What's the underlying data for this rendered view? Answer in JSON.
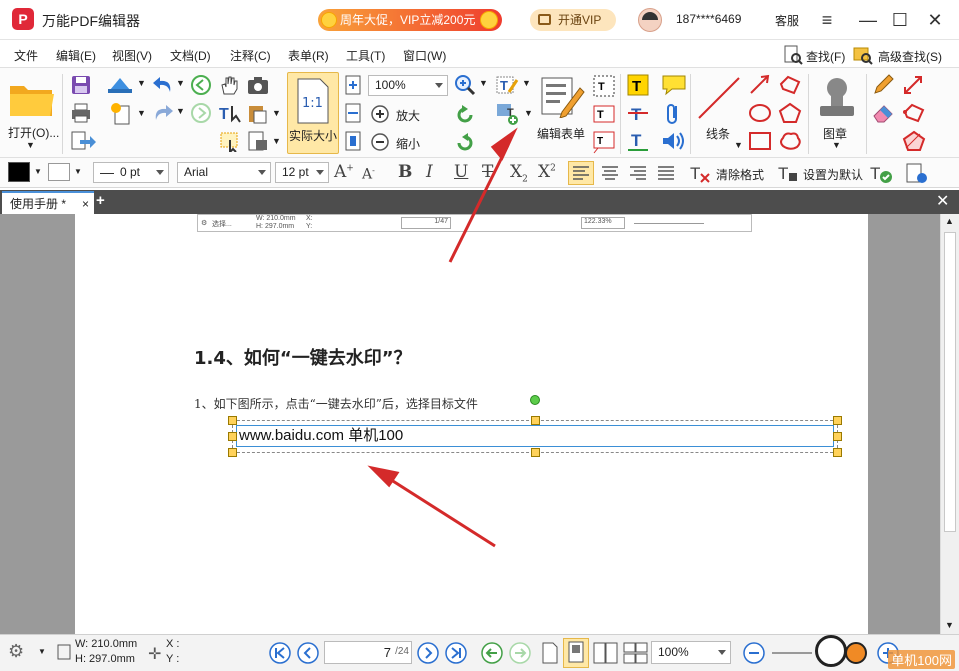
{
  "app": {
    "logo_letter": "P",
    "title": "万能PDF编辑器"
  },
  "promo": {
    "label": "周年大促，VIP立减200元"
  },
  "vip": {
    "label": "开通VIP"
  },
  "user": {
    "phone": "187****6469",
    "service": "客服"
  },
  "window": {
    "menu_icon": "hamburger-icon",
    "min": "—",
    "max": "☐",
    "close": "✕"
  },
  "menu": {
    "items": [
      "文件",
      "编辑(E)",
      "视图(V)",
      "文档(D)",
      "注释(C)",
      "表单(R)",
      "工具(T)",
      "窗口(W)"
    ],
    "search": "查找(F)",
    "advanced_search": "高级查找(S)"
  },
  "toolbar": {
    "open": "打开(O)...",
    "actual_size": "实际大小",
    "actual_size_icon": "1:1",
    "zoom_value": "100%",
    "zoom_in": "放大",
    "zoom_out": "缩小",
    "edit_form": "编辑表单",
    "lines": "线条",
    "stamp": "图章"
  },
  "format": {
    "stroke_width": "0 pt",
    "font": "Arial",
    "font_size": "12 pt",
    "clear_format": "清除格式",
    "set_default": "设置为默认"
  },
  "tabs": {
    "active": "使用手册 *",
    "close": "×",
    "add": "+",
    "close_all": "✕"
  },
  "document": {
    "snippet_labels": [
      "选择...",
      "W: 210.0mm",
      "H: 297.0mm",
      "X:",
      "Y:",
      "1/47",
      "122.33%"
    ],
    "heading": "1.4、如何“一键去水印”？",
    "paragraph": "1、如下图所示，点击“一键去水印”后，选择目标文件",
    "edit_text": "www.baidu.com   单机100"
  },
  "status": {
    "width": "W: 210.0mm",
    "height": "H: 297.0mm",
    "x": "X :",
    "y": "Y :",
    "page_current": "7",
    "page_total": "/24",
    "zoom": "100%",
    "watermark": "单机100网"
  },
  "colors": {
    "accent": "#e02838",
    "arrow": "#d42a2a",
    "handle": "#ffd25b",
    "selection": "#3b8fd6"
  }
}
